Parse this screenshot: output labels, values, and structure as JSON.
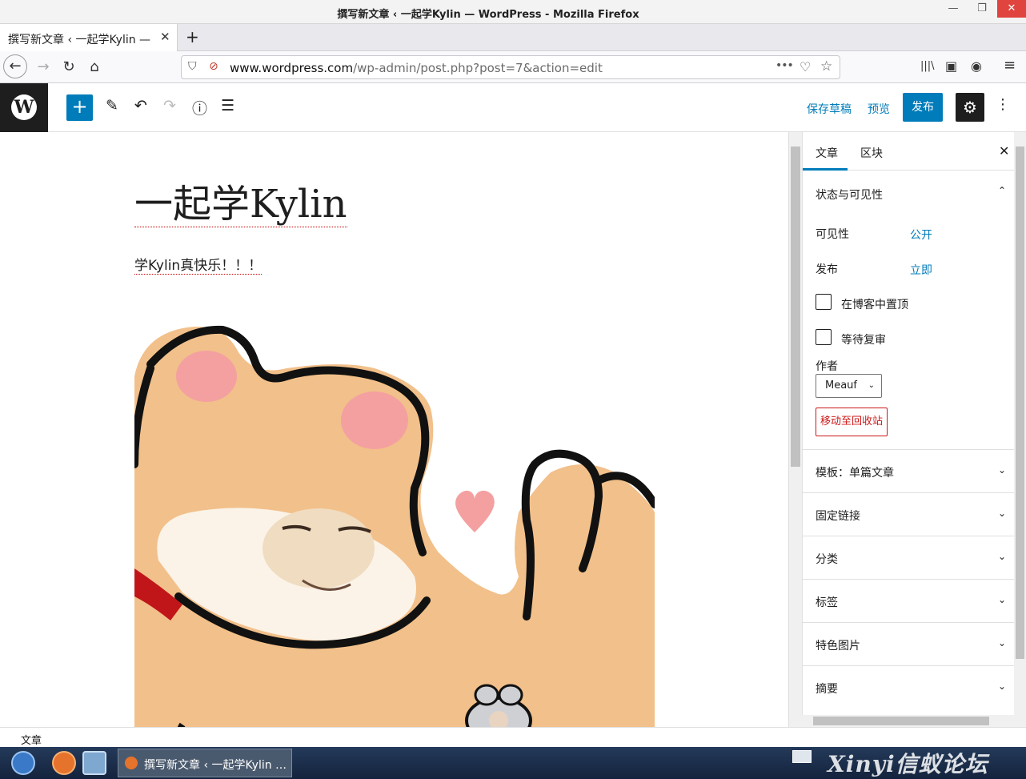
{
  "window": {
    "title": "撰写新文章 ‹ 一起学Kylin — WordPress - Mozilla Firefox",
    "minimize_glyph": "—",
    "maximize_glyph": "❐",
    "close_glyph": "✕"
  },
  "tabs": [
    {
      "label": "撰写新文章 ‹ 一起学Kylin — WordPress",
      "close_glyph": "✕"
    }
  ],
  "new_tab_glyph": "+",
  "nav": {
    "url_domain": "www.wordpress.com",
    "url_path": "/wp-admin/post.php?post=7&action=edit",
    "back_glyph": "←",
    "forward_glyph": "→",
    "reload_glyph": "↻",
    "home_glyph": "⌂",
    "more_glyph": "•••",
    "pocket_glyph": "♡",
    "star_glyph": "☆",
    "library_glyph": "|||\\",
    "sidebar_glyph": "▣",
    "account_glyph": "◉",
    "menu_glyph": "≡"
  },
  "wp_toolbar": {
    "logo_glyph": "W",
    "add_glyph": "+",
    "tools_glyph": "✎",
    "undo_glyph": "↶",
    "redo_glyph": "↷",
    "info_glyph": "ⓘ",
    "outline_glyph": "☰",
    "save_draft_label": "保存草稿",
    "preview_label": "预览",
    "publish_label": "发布",
    "settings_glyph": "⚙",
    "more_glyph": "⋮"
  },
  "post": {
    "title": "一起学Kylin",
    "paragraph": "学Kylin真快乐！！！"
  },
  "sidebar": {
    "tab_post": "文章",
    "tab_block": "区块",
    "close_glyph": "✕",
    "status_panel": {
      "title": "状态与可见性",
      "visibility_label": "可见性",
      "visibility_value": "公开",
      "publish_label": "发布",
      "publish_value": "立即",
      "sticky_label": "在博客中置顶",
      "pending_label": "等待复审",
      "author_label": "作者",
      "author_value": "Meauf",
      "trash_label": "移动至回收站"
    },
    "panels": [
      {
        "title": "模板：单篇文章"
      },
      {
        "title": "固定链接"
      },
      {
        "title": "分类"
      },
      {
        "title": "标签"
      },
      {
        "title": "特色图片"
      },
      {
        "title": "摘要"
      }
    ],
    "expand_glyph": "⌄",
    "collapse_glyph": "⌃"
  },
  "footer": {
    "breadcrumb": "文章"
  },
  "taskbar": {
    "window_label": "撰写新文章 ‹ 一起学Kylin …",
    "watermark": "Xinyi信蚁论坛"
  }
}
